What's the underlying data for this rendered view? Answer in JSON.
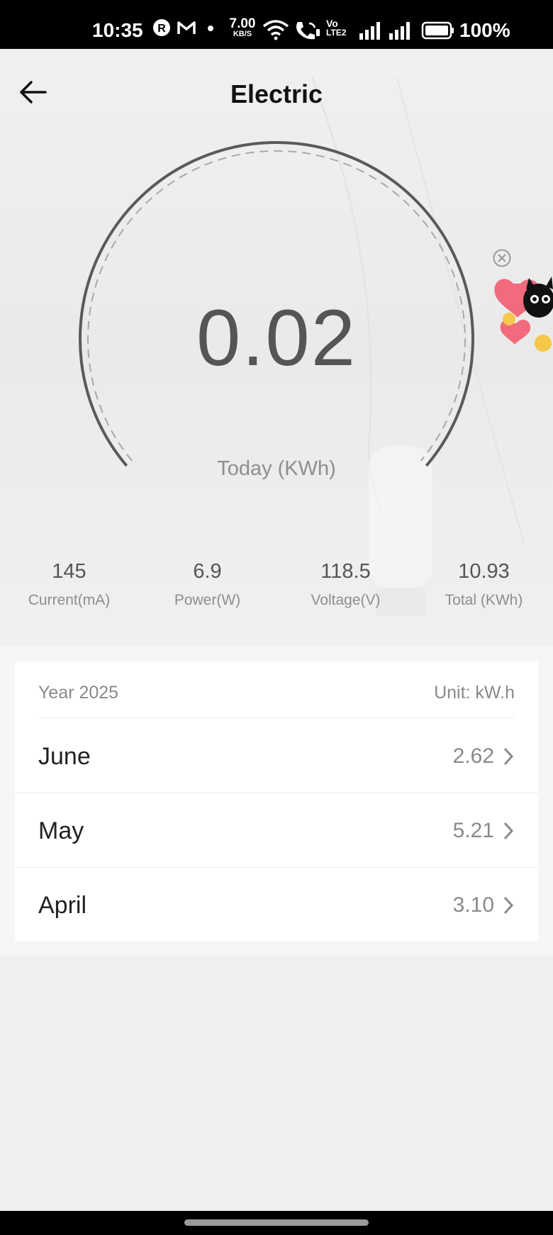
{
  "status_bar": {
    "time": "10:35",
    "network_speed_value": "7.00",
    "network_speed_unit": "KB/S",
    "volte_label_top": "Vo",
    "volte_label_bottom": "LTE2",
    "battery": "100%"
  },
  "header": {
    "title": "Electric"
  },
  "gauge": {
    "value": "0.02",
    "label": "Today (KWh)"
  },
  "metrics": [
    {
      "value": "145",
      "label": "Current(mA)"
    },
    {
      "value": "6.9",
      "label": "Power(W)"
    },
    {
      "value": "118.5",
      "label": "Voltage(V)"
    },
    {
      "value": "10.93",
      "label": "Total (KWh)"
    }
  ],
  "history": {
    "year_label": "Year 2025",
    "unit_label": "Unit: kW.h",
    "rows": [
      {
        "month": "June",
        "value": "2.62"
      },
      {
        "month": "May",
        "value": "5.21"
      },
      {
        "month": "April",
        "value": "3.10"
      }
    ]
  },
  "colors": {
    "gauge_stroke": "#5a5a5a",
    "gauge_dash": "#a8a8a8",
    "text_dark": "#222222",
    "text_muted": "#8a8a8a"
  }
}
